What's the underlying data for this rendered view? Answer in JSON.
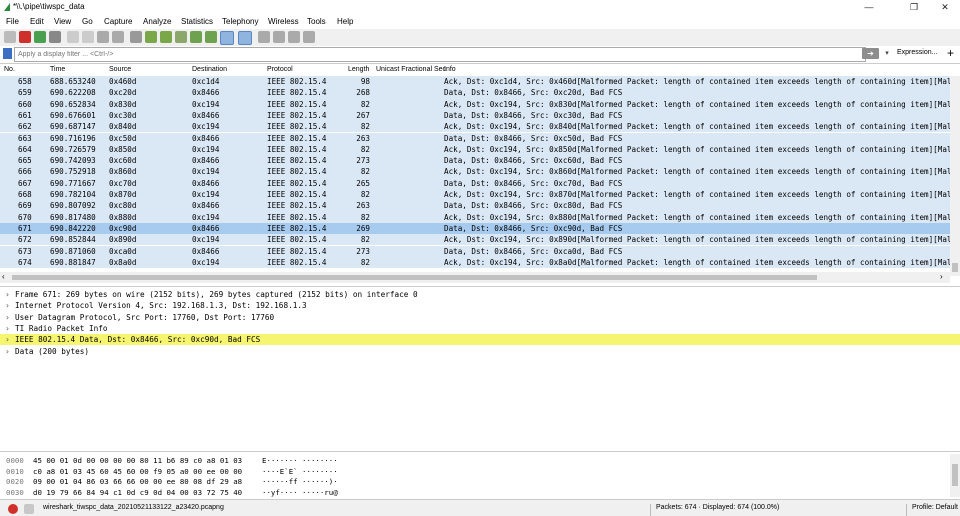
{
  "window": {
    "title": "*\\\\.\\pipe\\tiwspc_data",
    "min": "—",
    "max": "❐",
    "close": "✕"
  },
  "menu": [
    "File",
    "Edit",
    "View",
    "Go",
    "Capture",
    "Analyze",
    "Statistics",
    "Telephony",
    "Wireless",
    "Tools",
    "Help"
  ],
  "filter": {
    "placeholder": "Apply a display filter ... <Ctrl-/>",
    "apply": "➔",
    "dropdown": "▾",
    "expression": "Expression...",
    "add": "+"
  },
  "columns": [
    "No.",
    "Time",
    "Source",
    "Destination",
    "Protocol",
    "Length",
    "Unicast Fractional Sec",
    "Info"
  ],
  "packets": [
    {
      "no": "658",
      "time": "688.653240",
      "src": "0x460d",
      "dst": "0xc1d4",
      "proto": "IEEE 802.15.4",
      "len": "98",
      "info": "Ack, Dst: 0xc1d4, Src: 0x460d[Malformed Packet: length of contained item exceeds length of containing item][Mal"
    },
    {
      "no": "659",
      "time": "690.622208",
      "src": "0xc20d",
      "dst": "0x8466",
      "proto": "IEEE 802.15.4",
      "len": "268",
      "info": "Data, Dst: 0x8466, Src: 0xc20d, Bad FCS"
    },
    {
      "no": "660",
      "time": "690.652834",
      "src": "0x830d",
      "dst": "0xc194",
      "proto": "IEEE 802.15.4",
      "len": "82",
      "info": "Ack, Dst: 0xc194, Src: 0x830d[Malformed Packet: length of contained item exceeds length of containing item][Mal"
    },
    {
      "no": "661",
      "time": "690.676601",
      "src": "0xc30d",
      "dst": "0x8466",
      "proto": "IEEE 802.15.4",
      "len": "267",
      "info": "Data, Dst: 0x8466, Src: 0xc30d, Bad FCS"
    },
    {
      "no": "662",
      "time": "690.687147",
      "src": "0x840d",
      "dst": "0xc194",
      "proto": "IEEE 802.15.4",
      "len": "82",
      "info": "Ack, Dst: 0xc194, Src: 0x840d[Malformed Packet: length of contained item exceeds length of containing item][Mal"
    },
    {
      "no": "663",
      "time": "690.716196",
      "src": "0xc50d",
      "dst": "0x8466",
      "proto": "IEEE 802.15.4",
      "len": "263",
      "info": "Data, Dst: 0x8466, Src: 0xc50d, Bad FCS"
    },
    {
      "no": "664",
      "time": "690.726579",
      "src": "0x850d",
      "dst": "0xc194",
      "proto": "IEEE 802.15.4",
      "len": "82",
      "info": "Ack, Dst: 0xc194, Src: 0x850d[Malformed Packet: length of contained item exceeds length of containing item][Mal"
    },
    {
      "no": "665",
      "time": "690.742093",
      "src": "0xc60d",
      "dst": "0x8466",
      "proto": "IEEE 802.15.4",
      "len": "273",
      "info": "Data, Dst: 0x8466, Src: 0xc60d, Bad FCS"
    },
    {
      "no": "666",
      "time": "690.752918",
      "src": "0x860d",
      "dst": "0xc194",
      "proto": "IEEE 802.15.4",
      "len": "82",
      "info": "Ack, Dst: 0xc194, Src: 0x860d[Malformed Packet: length of contained item exceeds length of containing item][Mal"
    },
    {
      "no": "667",
      "time": "690.771667",
      "src": "0xc70d",
      "dst": "0x8466",
      "proto": "IEEE 802.15.4",
      "len": "265",
      "info": "Data, Dst: 0x8466, Src: 0xc70d, Bad FCS"
    },
    {
      "no": "668",
      "time": "690.782104",
      "src": "0x870d",
      "dst": "0xc194",
      "proto": "IEEE 802.15.4",
      "len": "82",
      "info": "Ack, Dst: 0xc194, Src: 0x870d[Malformed Packet: length of contained item exceeds length of containing item][Mal"
    },
    {
      "no": "669",
      "time": "690.807092",
      "src": "0xc80d",
      "dst": "0x8466",
      "proto": "IEEE 802.15.4",
      "len": "263",
      "info": "Data, Dst: 0x8466, Src: 0xc80d, Bad FCS"
    },
    {
      "no": "670",
      "time": "690.817480",
      "src": "0x880d",
      "dst": "0xc194",
      "proto": "IEEE 802.15.4",
      "len": "82",
      "info": "Ack, Dst: 0xc194, Src: 0x880d[Malformed Packet: length of contained item exceeds length of containing item][Mal"
    },
    {
      "no": "671",
      "time": "690.842220",
      "src": "0xc90d",
      "dst": "0x8466",
      "proto": "IEEE 802.15.4",
      "len": "269",
      "info": "Data, Dst: 0x8466, Src: 0xc90d, Bad FCS",
      "selected": true
    },
    {
      "no": "672",
      "time": "690.852844",
      "src": "0x890d",
      "dst": "0xc194",
      "proto": "IEEE 802.15.4",
      "len": "82",
      "info": "Ack, Dst: 0xc194, Src: 0x890d[Malformed Packet: length of contained item exceeds length of containing item][Mal"
    },
    {
      "no": "673",
      "time": "690.871060",
      "src": "0xca0d",
      "dst": "0x8466",
      "proto": "IEEE 802.15.4",
      "len": "273",
      "info": "Data, Dst: 0x8466, Src: 0xca0d, Bad FCS"
    },
    {
      "no": "674",
      "time": "690.881847",
      "src": "0x8a0d",
      "dst": "0xc194",
      "proto": "IEEE 802.15.4",
      "len": "82",
      "info": "Ack, Dst: 0xc194, Src: 0x8a0d[Malformed Packet: length of contained item exceeds length of containing item][Mal"
    }
  ],
  "details": [
    {
      "text": "Frame 671: 269 bytes on wire (2152 bits), 269 bytes captured (2152 bits) on interface 0",
      "highlight": false
    },
    {
      "text": "Internet Protocol Version 4, Src: 192.168.1.3, Dst: 192.168.1.3",
      "highlight": false
    },
    {
      "text": "User Datagram Protocol, Src Port: 17760, Dst Port: 17760",
      "highlight": false
    },
    {
      "text": "TI Radio Packet Info",
      "highlight": false
    },
    {
      "text": "IEEE 802.15.4 Data, Dst: 0x8466, Src: 0xc90d, Bad FCS",
      "highlight": true
    },
    {
      "text": "Data (200 bytes)",
      "highlight": false
    }
  ],
  "chevron": "›",
  "bytes": [
    {
      "off": "0000",
      "hex": "45 00 01 0d 00 00 00 00  80 11 b6 89 c0 a8 01 03",
      "ascii": "E·······  ········"
    },
    {
      "off": "0010",
      "hex": "c0 a8 01 03 45 60 45 60  00 f9 05 a0 00 ee 00 00",
      "ascii": "····E`E`  ········"
    },
    {
      "off": "0020",
      "hex": "09 00 01 04 86 03 66 66  00 00 ee 80 08 df 29 a8",
      "ascii": "······ff  ······)·"
    },
    {
      "off": "0030",
      "hex": "d0 19 79 66 84 94 c1 0d  c9 0d 04 00 03 72 75 40",
      "ascii": "··yf····  ·····ru@"
    }
  ],
  "status": {
    "file": "wireshark_tiwspc_data_20210521133122_a23420.pcapng",
    "packets": "Packets: 674 · Displayed: 674 (100.0%)",
    "profile": "Profile: Default"
  }
}
